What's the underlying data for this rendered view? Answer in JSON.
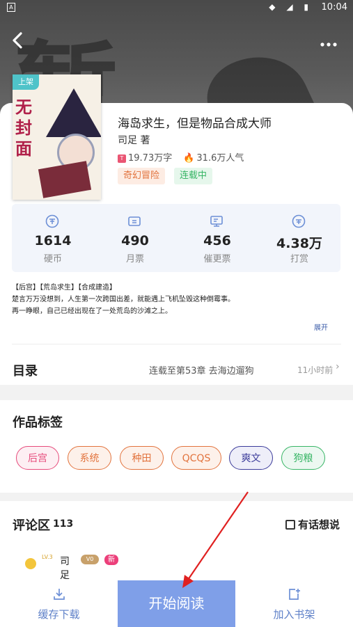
{
  "status_bar": {
    "time": "10:04",
    "left_badge": "A"
  },
  "colors": {
    "accent": "#7f9fe8",
    "link": "#5e80c8",
    "genre": "#e2733d",
    "serial": "#37b565"
  },
  "book": {
    "cover_badge": "上架",
    "cover_text": "无封面",
    "title": "海岛求生，但是物品合成大师",
    "author": "司足 著",
    "word_count": "19.73万字",
    "popularity": "31.6万人气",
    "genre": "奇幻冒险",
    "status": "连载中"
  },
  "metrics": [
    {
      "icon": "coin-icon",
      "value": "1614",
      "label": "硬币"
    },
    {
      "icon": "ticket-icon",
      "value": "490",
      "label": "月票"
    },
    {
      "icon": "monitor-icon",
      "value": "456",
      "label": "催更票"
    },
    {
      "icon": "reward-icon",
      "value": "4.38万",
      "label": "打赏"
    }
  ],
  "synopsis": {
    "line1": "【后宫】【荒岛求生】【合成建造】",
    "line2": "楚言万万没想到，人生第一次跨国出差，就能遇上飞机坠毁这种倒霉事。",
    "line3": "再一睁眼，自己已经出现在了一处荒岛的沙滩之上。",
    "expand": "展开"
  },
  "toc": {
    "title": "目录",
    "latest": "连载至第53章 去海边遛狗",
    "time": "11小时前"
  },
  "tags": {
    "title": "作品标签",
    "items": [
      {
        "label": "后宫",
        "color": "#e64a7b",
        "bg": "#fdeff3"
      },
      {
        "label": "系统",
        "color": "#e2733d",
        "bg": "#fdf1ea"
      },
      {
        "label": "种田",
        "color": "#e2733d",
        "bg": "#fdf1ea"
      },
      {
        "label": "QCQS",
        "color": "#e2733d",
        "bg": "#fdf1ea"
      },
      {
        "label": "爽文",
        "color": "#3b3b9a",
        "bg": "#eeeef9"
      },
      {
        "label": "狗粮",
        "color": "#37b565",
        "bg": "#ecf8f1"
      }
    ]
  },
  "comments": {
    "title": "评论区",
    "count": "113",
    "write": "有话想说",
    "user": {
      "level": "LV.3",
      "name": "司足",
      "vip": "V0",
      "badge": "新手"
    }
  },
  "bottom": {
    "download": "缓存下载",
    "read": "开始阅读",
    "shelf": "加入书架"
  }
}
